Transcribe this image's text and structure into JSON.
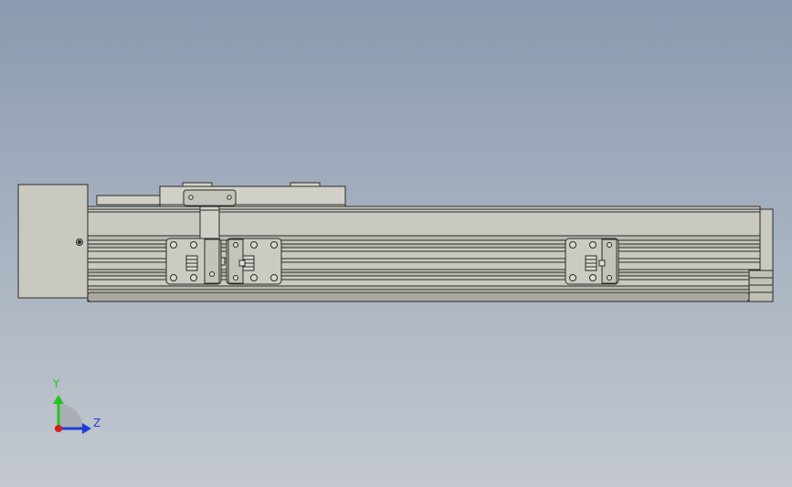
{
  "viewport": {
    "background_top": "#8a9ab0",
    "background_bottom": "#c3c8cf"
  },
  "model": {
    "parts": [
      "motor-housing",
      "actuator-rail",
      "carriage",
      "carriage-bracket",
      "mount-block-left",
      "mount-block-center",
      "mount-block-right"
    ],
    "colors": {
      "body": "#c9c9bf",
      "body_light": "#d8d8ce",
      "body_dark": "#a9a99f",
      "edge": "#2b2b2b"
    }
  },
  "triad": {
    "y_label": "Y",
    "z_label": "Z",
    "y_color": "#27c227",
    "z_color": "#1f3fd6",
    "x_color": "#d81c1c"
  }
}
